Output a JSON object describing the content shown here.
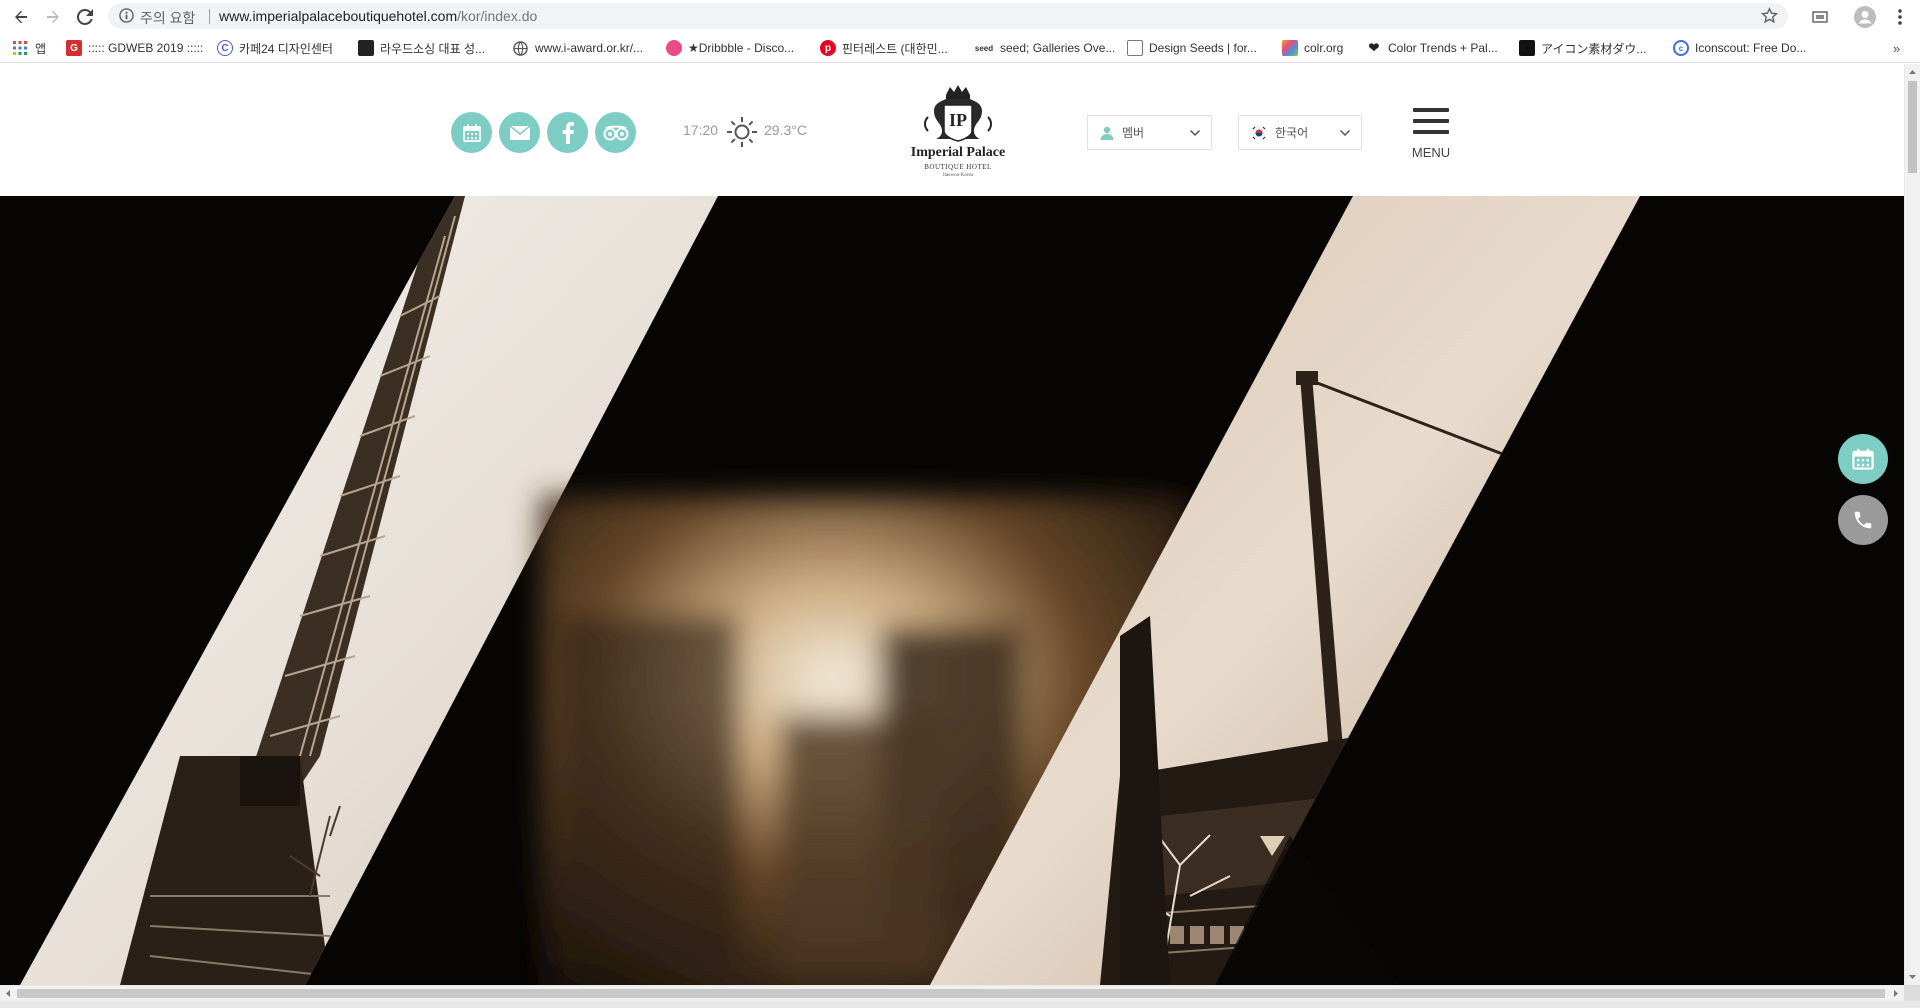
{
  "browser": {
    "security_warning": "주의 요함",
    "url_domain": "www.imperialpalaceboutiquehotel.com",
    "url_path": "/kor/index.do"
  },
  "bookmarks": [
    {
      "label": "앱",
      "icon": "apps-grid-icon",
      "color": "#e8453c"
    },
    {
      "label": "::::: GDWEB 2019 :::::",
      "icon": "gdweb-icon",
      "color": "#d62e2e"
    },
    {
      "label": "카페24 디자인센터",
      "icon": "cafe24-icon",
      "color": "#4a5cd6"
    },
    {
      "label": "라우드소싱 대표 성...",
      "icon": "loudsourcing-icon",
      "color": "#222222"
    },
    {
      "label": "www.i-award.or.kr/...",
      "icon": "globe-icon",
      "color": "#555555"
    },
    {
      "label": "★Dribbble - Disco...",
      "icon": "dribbble-icon",
      "color": "#ea4c89"
    },
    {
      "label": "핀터레스트 (대한민...",
      "icon": "pinterest-icon",
      "color": "#e60023"
    },
    {
      "label": "seed; Galleries Ove...",
      "icon": "seed-icon",
      "color": "#333333"
    },
    {
      "label": "Design Seeds | for...",
      "icon": "design-seeds-icon",
      "color": "#555555"
    },
    {
      "label": "colr.org",
      "icon": "colr-icon",
      "color": "#f5a623"
    },
    {
      "label": "Color Trends + Pal...",
      "icon": "heart-icon",
      "color": "#222222"
    },
    {
      "label": "アイコン素材ダウ...",
      "icon": "icon-material-icon",
      "color": "#111111"
    },
    {
      "label": "Iconscout: Free Do...",
      "icon": "iconscout-icon",
      "color": "#3c6ef0"
    }
  ],
  "header": {
    "social_buttons": [
      {
        "icon": "calendar-icon"
      },
      {
        "icon": "mail-icon"
      },
      {
        "icon": "facebook-icon"
      },
      {
        "icon": "tripadvisor-icon"
      }
    ],
    "time": "17:20",
    "temperature": "29.3°C",
    "weather_icon": "sun-icon",
    "logo": {
      "name": "Imperial Palace",
      "sub": "BOUTIQUE HOTEL",
      "location": "Itaewon-Korea",
      "monogram": "IP"
    },
    "member_label": "멤버",
    "language_label": "한국어",
    "menu_label": "MENU",
    "accent_color": "#7ecdc4"
  },
  "floating": {
    "reservation_icon": "calendar-icon",
    "phone_icon": "phone-icon",
    "reservation_color": "#7ecdc4",
    "phone_color": "#9a9a9a"
  }
}
